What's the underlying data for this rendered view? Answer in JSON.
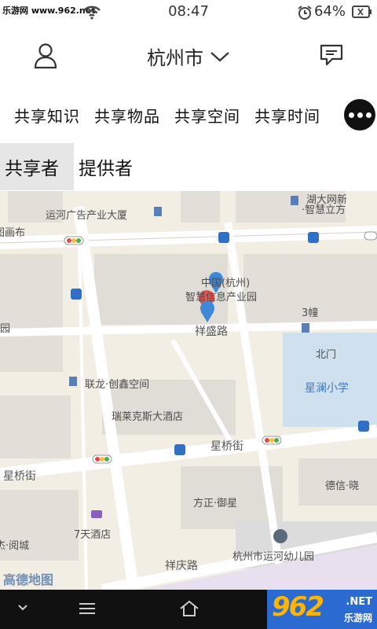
{
  "status_bar": {
    "watermark": "乐游网 www.962.net",
    "time": "08:47",
    "battery": "64%",
    "icons": [
      "wifi-icon",
      "alarm-icon",
      "battery-icon"
    ]
  },
  "header": {
    "city": "杭州市",
    "icons": [
      "user-icon",
      "chevron-down-icon",
      "message-icon"
    ]
  },
  "categories": [
    "共享知识",
    "共享物品",
    "共享空间",
    "共享时间"
  ],
  "role_tabs": {
    "items": [
      "共享者",
      "提供者"
    ],
    "active": "共享者"
  },
  "map": {
    "labels": {
      "ad_building": "运河广告产业大厦",
      "hangzhou_park_1": "中国(杭州)",
      "hangzhou_park_2": "智慧信息产业园",
      "xiangsheng_road": "祥盛路",
      "building3": "3幢",
      "north_gate": "北门",
      "lianlong": "联龙·创鑫空间",
      "school": "星澜小学",
      "hotel_ruilaikesi": "瑞莱克斯大酒店",
      "xingqiao_street": "星桥街",
      "xingqiao_street_left": "星桥街",
      "fangzheng": "方正·御星",
      "dexin": "德信·晓",
      "seven_days": "7天酒店",
      "kindergarten": "杭州市运河幼儿园",
      "xiangqing_road": "祥庆路",
      "ajie": "杰·阅城",
      "ci_wisdom": "·智慧立方",
      "top_right": "湖大网新",
      "left_edge_1": "中图画布",
      "left_edge_2": "园"
    },
    "attribution": "高德地图",
    "colors": {
      "background": "#f3eee4",
      "road": "#ffffff",
      "block": "#dedbd5",
      "school": "#cfe0ee",
      "marker_blue": "#3f88d9",
      "marker_red": "#e05353"
    }
  },
  "nav": {
    "icons": [
      "chevron-down-icon",
      "menu-icon",
      "home-icon"
    ],
    "brand_big": "962",
    "brand_net": ".NET",
    "brand_cn": "乐游网"
  }
}
